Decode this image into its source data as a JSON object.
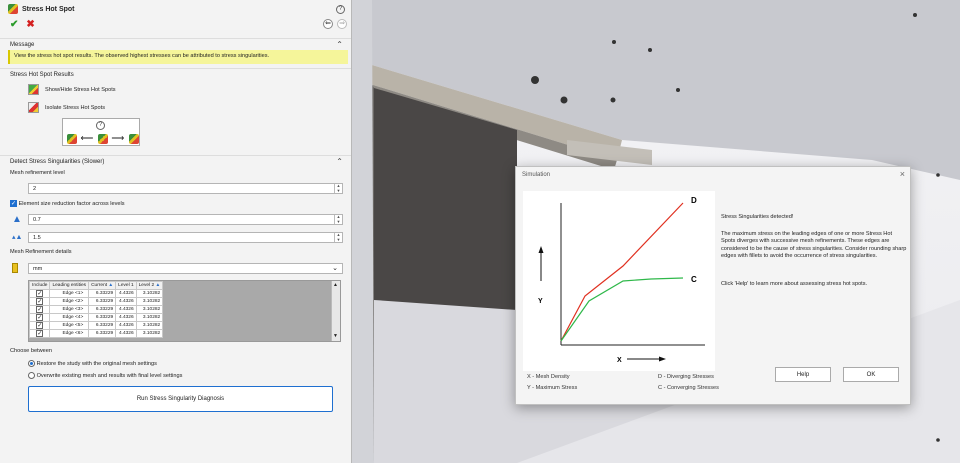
{
  "panel": {
    "title": "Stress Hot Spot",
    "message_header": "Message",
    "message": "View the stress hot spot results. The observed highest stresses can be attributed to stress singularities.",
    "results_header": "Stress Hot Spot Results",
    "show_hide": "Show/Hide Stress Hot Spots",
    "isolate": "Isolate Stress Hot Spots",
    "detect_header": "Detect Stress Singularities (Slower)",
    "mesh_level_label": "Mesh refinement level",
    "mesh_level_value": "2",
    "element_size_label": "Element size reduction factor across levels",
    "factor1_value": "0.7",
    "factor2_value": "1.5",
    "details_label": "Mesh Refinement details",
    "unit_value": "mm",
    "table": {
      "headers": [
        "Include",
        "Leading entities",
        "Current",
        "Level 1",
        "Level 2"
      ],
      "rows": [
        [
          "Edge <1>",
          "6.33229",
          "4.4326",
          "3.10282"
        ],
        [
          "Edge <2>",
          "6.33229",
          "4.4326",
          "3.10282"
        ],
        [
          "Edge <3>",
          "6.33229",
          "4.4326",
          "3.10282"
        ],
        [
          "Edge <4>",
          "6.33229",
          "4.4326",
          "3.10282"
        ],
        [
          "Edge <5>",
          "6.33229",
          "4.4326",
          "3.10282"
        ],
        [
          "Edge <6>",
          "6.33229",
          "4.4326",
          "3.10282"
        ]
      ]
    },
    "choose_label": "Choose between",
    "radio1": "Restore the study with the original mesh settings",
    "radio2": "Overwrite existing mesh and results with final level settings",
    "run_button": "Run Stress Singularity Diagnosis"
  },
  "dialog": {
    "title": "Simulation",
    "heading": "Stress Singularities detected!",
    "body": "The maximum stress on the leading edges of one or more Stress Hot Spots diverges with successive mesh refinements. These edges are considered to be the cause of stress singularities. Consider rounding sharp edges with fillets to avoid the occurrence of  stress singularities.",
    "help_text": "Click 'Help' to learn more about assessing stress hot spots.",
    "help_button": "Help",
    "ok_button": "OK",
    "legend": {
      "x": "X - Mesh Density",
      "y": "Y - Maximum Stress",
      "d": "D - Diverging Stresses",
      "c": "C - Converging Stresses"
    },
    "plot": {
      "x_label": "X",
      "y_label": "Y",
      "label_d": "D",
      "label_c": "C",
      "colors": {
        "diverging": "#e03020",
        "converging": "#2fb84a"
      }
    }
  }
}
